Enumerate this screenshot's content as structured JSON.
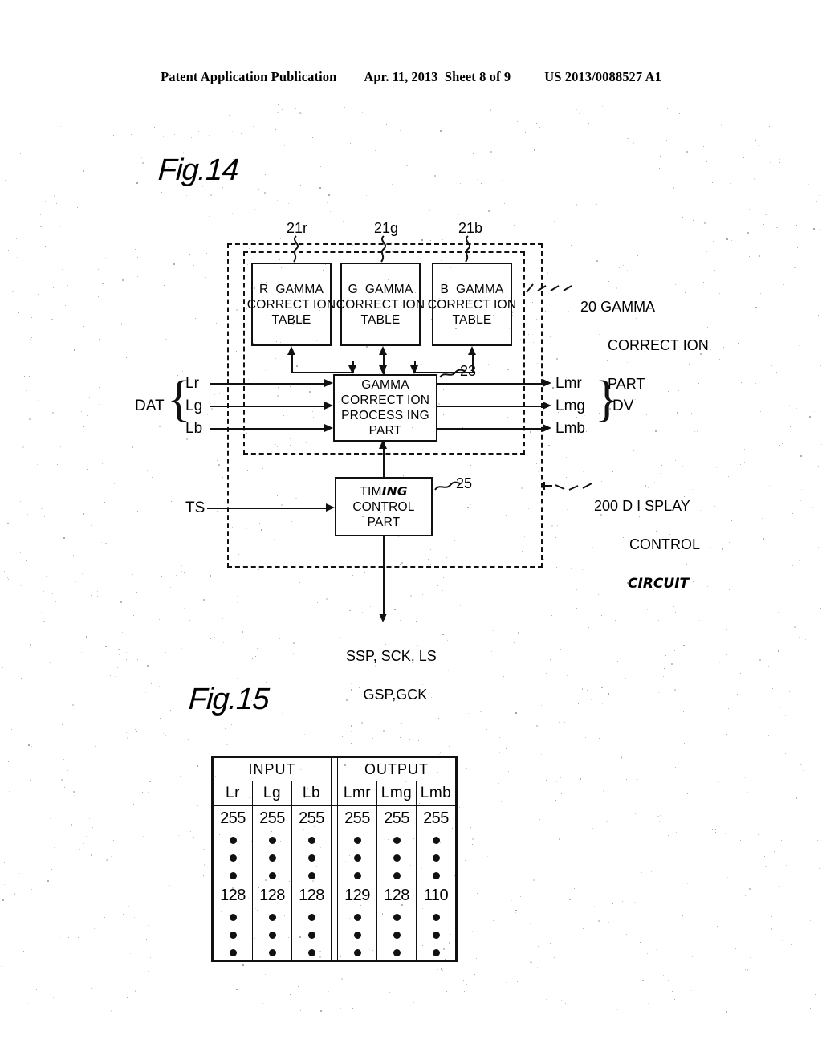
{
  "header": {
    "publication": "Patent Application Publication",
    "date": "Apr. 11, 2013",
    "sheet": "Sheet 8 of 9",
    "patent_number": "US 2013/0088527 A1"
  },
  "fig14": {
    "title": "Fig.14",
    "ref_21r": "21r",
    "ref_21g": "21g",
    "ref_21b": "21b",
    "ref_23": "23",
    "ref_25": "25",
    "table_r": {
      "l1": "R  GAMMA",
      "l2": "CORRECT ION",
      "l3": "TABLE"
    },
    "table_g": {
      "l1": "G  GAMMA",
      "l2": "CORRECT ION",
      "l3": "TABLE"
    },
    "table_b": {
      "l1": "B  GAMMA",
      "l2": "CORRECT ION",
      "l3": "TABLE"
    },
    "gamma_proc": {
      "l1": "GAMMA",
      "l2": "CORRECT ION",
      "l3": "PROCESS ING",
      "l4": "PART"
    },
    "timing": {
      "l1a": "TIM",
      "l1b": "ING",
      "l2": "CONTROL",
      "l3": "PART"
    },
    "callout_20": {
      "num": "20",
      "l1": "GAMMA",
      "l2": "CORRECT ION",
      "l3": "PART"
    },
    "callout_200": {
      "num": "200",
      "l1": "D I SPLAY",
      "l2": "CONTROL",
      "l3": "CIRCUIT"
    },
    "input_group": "DAT",
    "inputs": [
      "Lr",
      "Lg",
      "Lb"
    ],
    "output_group": "DV",
    "outputs": [
      "Lmr",
      "Lmg",
      "Lmb"
    ],
    "ts_label": "TS",
    "timing_outputs": {
      "l1": "SSP, SCK, LS",
      "l2": "GSP,GCK"
    }
  },
  "fig15": {
    "title": "Fig.15",
    "group_headers": [
      "INPUT",
      "OUTPUT"
    ],
    "columns": [
      "Lr",
      "Lg",
      "Lb",
      "Lmr",
      "Lmg",
      "Lmb"
    ],
    "rows": [
      {
        "type": "value",
        "values": [
          "255",
          "255",
          "255",
          "255",
          "255",
          "255"
        ]
      },
      {
        "type": "dots"
      },
      {
        "type": "dots"
      },
      {
        "type": "dots"
      },
      {
        "type": "value",
        "values": [
          "128",
          "128",
          "128",
          "129",
          "128",
          "110"
        ]
      },
      {
        "type": "dots"
      },
      {
        "type": "dots"
      },
      {
        "type": "dots"
      }
    ]
  },
  "colors": {
    "ink": "#111111",
    "paper": "#ffffff"
  }
}
